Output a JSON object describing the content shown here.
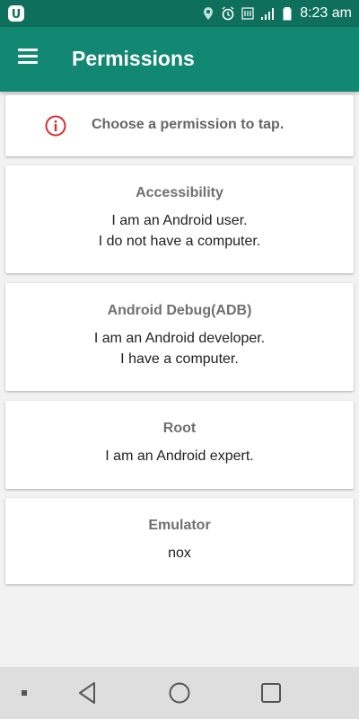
{
  "status_bar": {
    "time": "8:23 am"
  },
  "toolbar": {
    "title": "Permissions",
    "menu_icon": "hamburger-menu-icon"
  },
  "info": {
    "text": "Choose a permission to tap.",
    "icon": "info-icon"
  },
  "cards": [
    {
      "title": "Accessibility",
      "lines": [
        "I am an Android user.",
        "I do not have a computer."
      ]
    },
    {
      "title": "Android Debug(ADB)",
      "lines": [
        "I am an Android developer.",
        "I have a computer."
      ]
    },
    {
      "title": "Root",
      "lines": [
        "I am an Android expert."
      ]
    },
    {
      "title": "Emulator",
      "lines": [
        "nox"
      ]
    }
  ],
  "colors": {
    "status_bar": "#0e6f5c",
    "toolbar": "#128772",
    "info_icon": "#d32f2f",
    "background": "#f2f2f2"
  }
}
